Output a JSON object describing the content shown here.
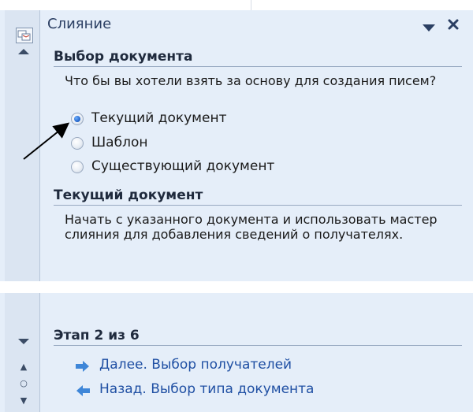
{
  "pane": {
    "title": "Слияние",
    "icons": {
      "pane_icon": "mail-merge-pane-icon",
      "dropdown": "triangle-down-icon",
      "close": "close-icon",
      "scroll_up": "scroll-up-arrow-icon",
      "scroll_down": "scroll-down-arrow-icon"
    }
  },
  "select_document": {
    "heading": "Выбор документа",
    "question": "Что бы вы хотели взять за основу для создания писем?",
    "options": [
      {
        "label": "Текущий документ",
        "checked": true
      },
      {
        "label": "Шаблон",
        "checked": false
      },
      {
        "label": "Существующий документ",
        "checked": false
      }
    ]
  },
  "current_document": {
    "heading": "Текущий документ",
    "description": "Начать с указанного документа и использовать мастер слияния для добавления сведений о получателях."
  },
  "step": {
    "heading": "Этап 2 из 6",
    "next": {
      "label": "Далее. Выбор получателей",
      "icon": "arrow-right-icon"
    },
    "back": {
      "label": "Назад. Выбор типа документа",
      "icon": "arrow-left-icon"
    }
  },
  "colors": {
    "pane_bg": "#e5eef9",
    "link": "#1f4fa3",
    "arrow_icon": "#3e86d8"
  }
}
